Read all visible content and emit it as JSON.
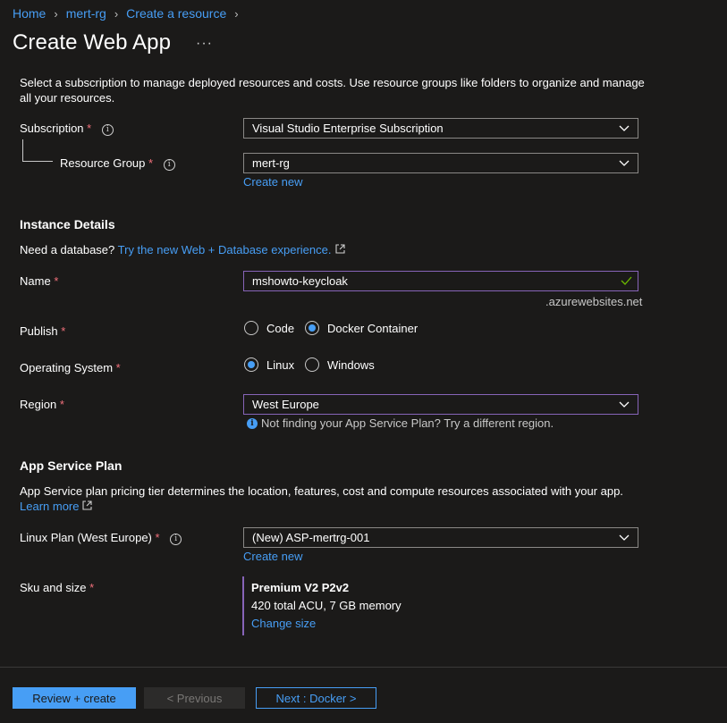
{
  "breadcrumb": {
    "items": [
      "Home",
      "mert-rg",
      "Create a resource"
    ]
  },
  "page_title": "Create Web App",
  "more_label": "···",
  "intro_text": "Select a subscription to manage deployed resources and costs. Use resource groups like folders to organize and manage all your resources.",
  "project": {
    "subscription_label": "Subscription",
    "subscription_value": "Visual Studio Enterprise Subscription",
    "resource_group_label": "Resource Group",
    "resource_group_value": "mert-rg",
    "create_new": "Create new"
  },
  "instance": {
    "heading": "Instance Details",
    "db_prompt": "Need a database?",
    "db_link": "Try the new Web + Database experience.",
    "name_label": "Name",
    "name_value": "mshowto-keycloak",
    "name_suffix": ".azurewebsites.net",
    "publish_label": "Publish",
    "publish_options": [
      "Code",
      "Docker Container"
    ],
    "publish_selected": "Docker Container",
    "os_label": "Operating System",
    "os_options": [
      "Linux",
      "Windows"
    ],
    "os_selected": "Linux",
    "region_label": "Region",
    "region_value": "West Europe",
    "region_hint": "Not finding your App Service Plan? Try a different region."
  },
  "plan": {
    "heading": "App Service Plan",
    "description": "App Service plan pricing tier determines the location, features, cost and compute resources associated with your app.",
    "learn_more": "Learn more",
    "linux_plan_label": "Linux Plan (West Europe)",
    "linux_plan_value": "(New) ASP-mertrg-001",
    "create_new": "Create new",
    "sku_label": "Sku and size",
    "sku_name": "Premium V2 P2v2",
    "sku_details": "420 total ACU, 7 GB memory",
    "change_size": "Change size"
  },
  "footer": {
    "review_create": "Review + create",
    "previous": "< Previous",
    "next": "Next : Docker >"
  },
  "colors": {
    "accent": "#479ef5",
    "primary_button": "#479ef5",
    "required": "#f1707b",
    "valid_check": "#6bb700",
    "focus_border": "#8764b8"
  },
  "required_mark": "*"
}
